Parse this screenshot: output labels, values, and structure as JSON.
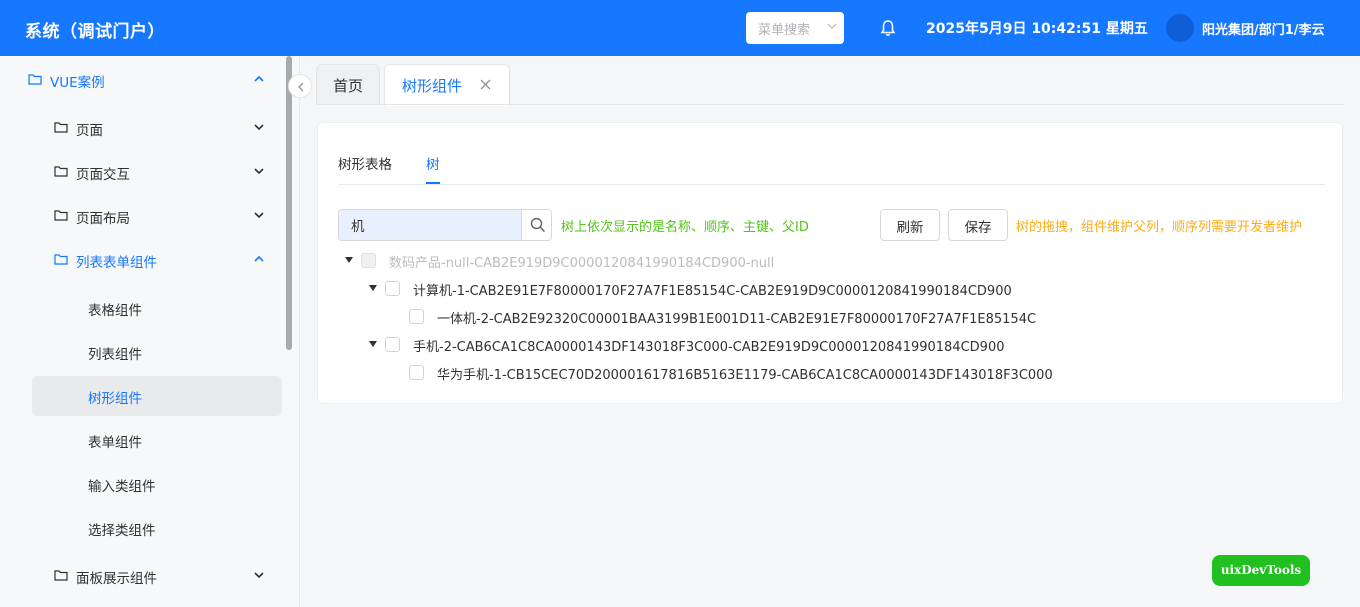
{
  "header": {
    "title": "系统（调试门户）",
    "menu_search_placeholder": "菜单搜索",
    "datetime": "2025年5月9日 10:42:51 星期五",
    "user": "阳光集团/部门1/李云",
    "color": "#1677ff"
  },
  "sidebar": {
    "items": [
      {
        "label": "VUE案例",
        "icon": "folder-icon",
        "expanded": true
      },
      {
        "label": "页面",
        "icon": "folder-icon",
        "expanded": false
      },
      {
        "label": "页面交互",
        "icon": "folder-icon",
        "expanded": false
      },
      {
        "label": "页面布局",
        "icon": "folder-icon",
        "expanded": false
      },
      {
        "label": "列表表单组件",
        "icon": "folder-icon",
        "expanded": true
      },
      {
        "label": "表格组件"
      },
      {
        "label": "列表组件"
      },
      {
        "label": "树形组件",
        "active": true
      },
      {
        "label": "表单组件"
      },
      {
        "label": "输入类组件"
      },
      {
        "label": "选择类组件"
      },
      {
        "label": "面板展示组件",
        "icon": "folder-icon",
        "expanded": false
      }
    ]
  },
  "tabs": {
    "home": "首页",
    "current": "树形组件"
  },
  "content": {
    "inner_tabs": [
      "树形表格",
      "树"
    ],
    "active_inner_tab": "树",
    "search_value": "机",
    "hint_left": "树上依次显示的是名称、顺序、主键、父ID",
    "refresh": "刷新",
    "save": "保存",
    "hint_right": "树的拖拽，组件维护父列，顺序列需要开发者维护",
    "tree": [
      {
        "text": "数码产品-null-CAB2E919D9C0000120841990184CD900-null",
        "disabled": true,
        "expanded": true
      },
      {
        "text": "计算机-1-CAB2E91E7F80000170F27A7F1E85154C-CAB2E919D9C0000120841990184CD900",
        "expanded": true
      },
      {
        "text": "一体机-2-CAB2E92320C00001BAA3199B1E001D11-CAB2E91E7F80000170F27A7F1E85154C"
      },
      {
        "text": "手机-2-CAB6CA1C8CA0000143DF143018F3C000-CAB2E919D9C0000120841990184CD900",
        "expanded": true
      },
      {
        "text": "华为手机-1-CB15CEC70D200001617816B5163E1179-CAB6CA1C8CA0000143DF143018F3C000"
      }
    ]
  },
  "devtools_label": "uixDevTools"
}
